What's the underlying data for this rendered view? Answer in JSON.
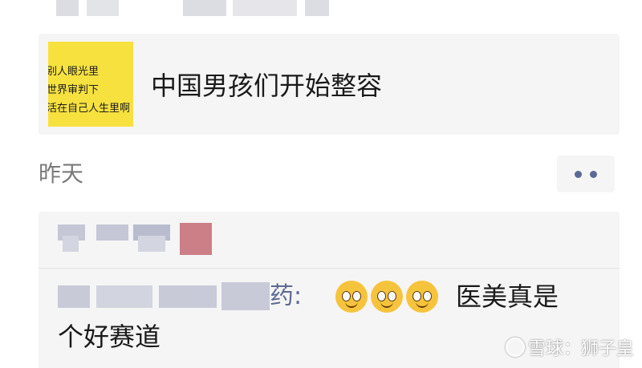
{
  "shared_article": {
    "thumbnail_lines": [
      "别人眼光里",
      "世界审判下",
      "活在自己人生里啊"
    ],
    "title": "中国男孩们开始整容"
  },
  "timestamp": "昨天",
  "comment": {
    "author_suffix": "药",
    "colon": ":",
    "emoji": [
      "wink-emoji",
      "wink-emoji",
      "wink-emoji"
    ],
    "text_line1": "医美真是",
    "text_line2": "个好赛道"
  },
  "watermark": "雪球：狮子皇",
  "colors": {
    "card_bg": "#f5f5f5",
    "link_blue": "#5b6a95",
    "thumbnail_yellow": "#f7e13f"
  }
}
